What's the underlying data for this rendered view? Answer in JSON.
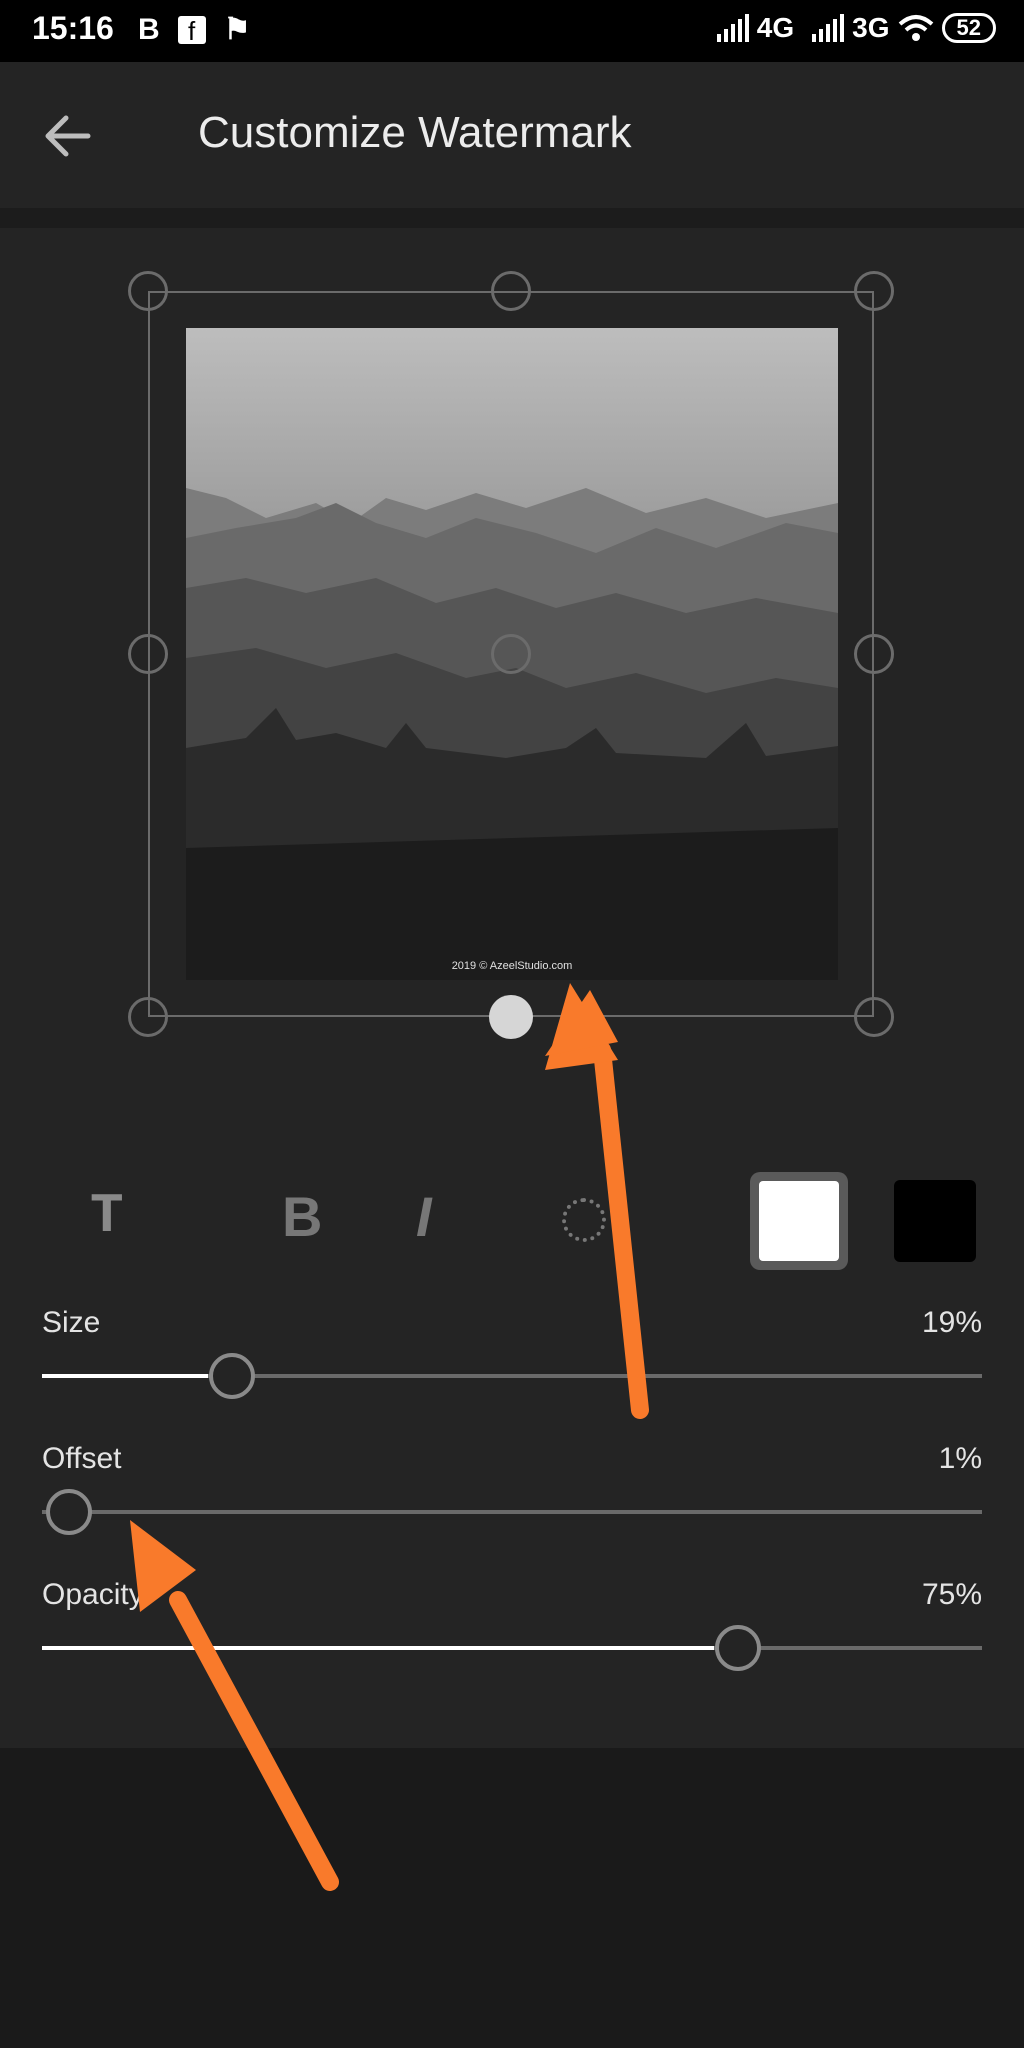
{
  "status_bar": {
    "time": "15:16",
    "notification_icons": [
      "b-icon",
      "facebook-icon",
      "flag-icon"
    ],
    "network_1": "4G",
    "network_2": "3G",
    "battery": "52"
  },
  "app_bar": {
    "title": "Customize Watermark",
    "back_icon": "arrow-left-icon"
  },
  "preview": {
    "watermark_text": "2019 © AzeelStudio.com"
  },
  "toolbar": {
    "text_icon": "T",
    "bold_icon": "B",
    "italic_icon": "I",
    "rotate_icon": "rotate-icon",
    "color_selected": "#FFFFFF",
    "color_alternate": "#000000"
  },
  "sliders": {
    "size": {
      "label": "Size",
      "value_text": "19%",
      "fraction": 0.19
    },
    "offset": {
      "label": "Offset",
      "value_text": "1%",
      "fraction": 0.01
    },
    "opacity": {
      "label": "Opacity",
      "value_text": "75%",
      "fraction": 0.75
    }
  },
  "colors": {
    "annotation_arrow": "#F97A2B",
    "background": "#242424"
  }
}
